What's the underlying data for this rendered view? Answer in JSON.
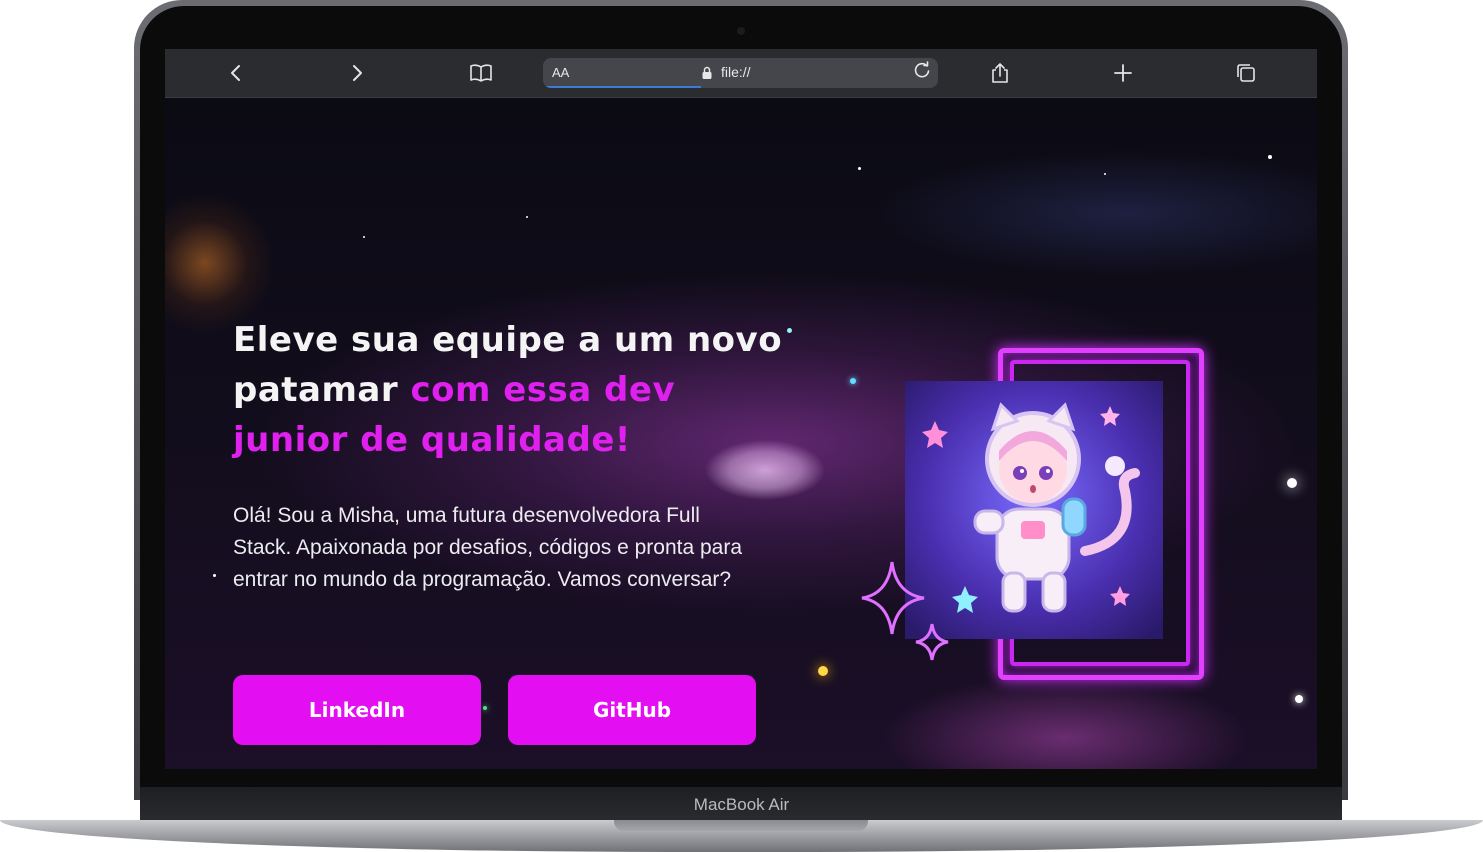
{
  "device": {
    "label": "MacBook Air"
  },
  "browser": {
    "reader_label": "AA",
    "url": "file://",
    "icons": {
      "back": "chevron-left-icon",
      "forward": "chevron-right-icon",
      "bookmarks": "book-icon",
      "share": "share-icon",
      "new_tab": "plus-icon",
      "tabs": "tabs-icon",
      "reload": "reload-icon",
      "lock": "lock-icon"
    },
    "load_progress": 0.4
  },
  "hero": {
    "headline_part1": "Eleve sua equipe a um novo patamar ",
    "headline_accent": "com essa dev junior de qualidade!",
    "intro": "Olá! Sou a Misha, uma futura desenvolvedora Full Stack. Apaixonada por desafios, códigos e pronta para entrar no mundo da programação. Vamos conversar?",
    "buttons": {
      "linkedin": "LinkedIn",
      "github": "GitHub"
    }
  },
  "colors": {
    "accent": "#e020ef",
    "button": "#e40ef2",
    "frame": "#e140ff"
  }
}
